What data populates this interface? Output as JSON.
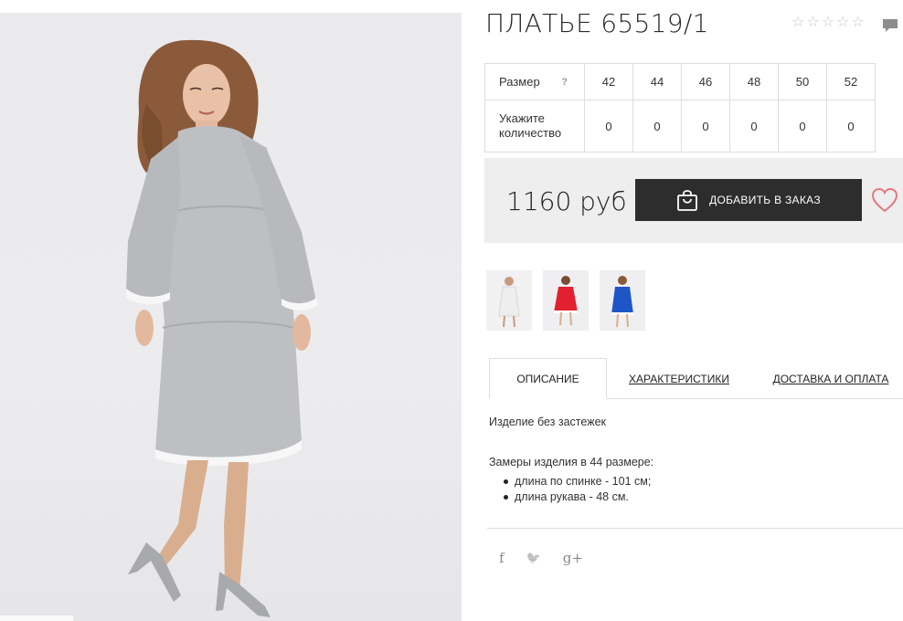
{
  "product": {
    "title": "ПЛАТЬЕ 65519/1",
    "rating_stars": [
      "☆",
      "☆",
      "☆",
      "☆",
      "☆"
    ],
    "rating_value": 0
  },
  "sizes_table": {
    "size_label": "Размер",
    "help_mark": "?",
    "sizes": [
      "42",
      "44",
      "46",
      "48",
      "50",
      "52"
    ],
    "qty_label": "Укажите количество",
    "quantities": [
      "0",
      "0",
      "0",
      "0",
      "0",
      "0"
    ]
  },
  "purchase": {
    "price": "1160 руб",
    "add_button": "ДОБАВИТЬ В ЗАКАЗ"
  },
  "thumbnails": [
    {
      "name": "white-dress",
      "dress_color": "#eeeeee"
    },
    {
      "name": "red-dress",
      "dress_color": "#e3202f"
    },
    {
      "name": "blue-dress",
      "dress_color": "#1e56c8"
    }
  ],
  "tabs": {
    "description": "ОПИСАНИЕ",
    "characteristics": "ХАРАКТЕРИСТИКИ",
    "delivery": "ДОСТАВКА И ОПЛАТА"
  },
  "description": {
    "line1": "Изделие без застежек",
    "line2": "Замеры изделия в 44 размере:",
    "bullets": [
      "длина по спинке - 101 см;",
      "длина рукава - 48 см."
    ]
  },
  "share": {
    "facebook": "f",
    "twitter": "🐦",
    "google_plus": "g+"
  },
  "colors": {
    "button": "#2d2d2d",
    "buy_box": "#eeeeee",
    "heart": "#e07a82",
    "dress": "#bdbfc3"
  },
  "icons": [
    "comment-icon",
    "bag-icon",
    "heart-icon",
    "facebook-icon",
    "twitter-icon",
    "google-plus-icon"
  ]
}
